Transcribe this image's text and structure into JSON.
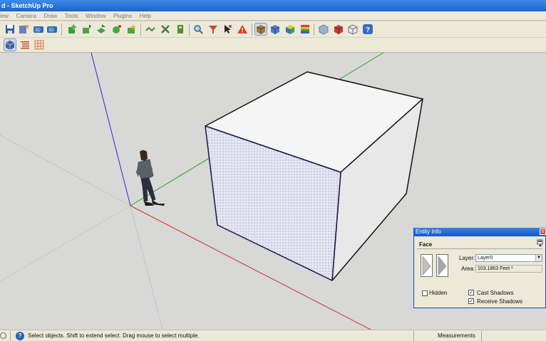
{
  "window": {
    "title": "d - SketchUp Pro"
  },
  "menu": [
    "View",
    "Camera",
    "Draw",
    "Tools",
    "Window",
    "Plugins",
    "Help"
  ],
  "menu_visible_text": [
    "iew",
    "Camera",
    "Draw",
    "Tools",
    "Window",
    "Plugins",
    "Help"
  ],
  "toolbar1": [
    {
      "icon": "save-icon",
      "color": "#3a5aa8"
    },
    {
      "icon": "save-model-icon",
      "color": "#6b7fc0"
    },
    {
      "icon": "upload-3dw-icon",
      "color": "#2f6ab5"
    },
    {
      "icon": "export-3dw-icon",
      "color": "#2f6ab5"
    },
    {
      "icon": "get-models-icon",
      "color": "#3c9a3a"
    },
    {
      "icon": "share-model-icon",
      "color": "#4aa444"
    },
    {
      "icon": "share-component-icon",
      "color": "#4aa444"
    },
    {
      "icon": "get-photo-texture-icon",
      "color": "#4aa444"
    },
    {
      "icon": "add-location-icon",
      "color": "#4aa444"
    },
    {
      "icon": "toggle-terrain-icon",
      "color": "#4a8a3a"
    },
    {
      "icon": "mirror-icon",
      "color": "#4a7a3a"
    },
    {
      "icon": "weld-icon",
      "color": "#5a8a2a"
    },
    {
      "icon": "zoom-magnifier-icon",
      "color": "#3060b0"
    },
    {
      "icon": "funnel-filter-icon",
      "color": "#c04a30"
    },
    {
      "icon": "select-arrow-icon",
      "color": "#222222"
    },
    {
      "icon": "warning-icon",
      "color": "#d64020"
    },
    {
      "icon": "shaded-box-icon",
      "color": "#a87840"
    },
    {
      "icon": "textured-box-icon",
      "color": "#5080c0"
    },
    {
      "icon": "colored-box-icon",
      "color": "#40a040"
    },
    {
      "icon": "rainbow-icon",
      "color": "#d04040"
    },
    {
      "icon": "component-box-icon",
      "color": "#6080b0"
    },
    {
      "icon": "red-box-icon",
      "color": "#c04040"
    },
    {
      "icon": "outline-box-icon",
      "color": "#808080"
    },
    {
      "icon": "help-icon",
      "color": "#3a6ac0"
    }
  ],
  "toolbar2": [
    {
      "icon": "component-cube-icon",
      "color": "#4060a0"
    },
    {
      "icon": "outliner-list-icon",
      "color": "#c05020"
    },
    {
      "icon": "spreadsheet-icon",
      "color": "#d08050"
    }
  ],
  "entity_info": {
    "title": "Entity Info",
    "close_label": "x",
    "type": "Face",
    "layer_label": "Layer:",
    "layer_value": "Layer0",
    "area_label": "Area:",
    "area_value": "103.1863 Feet ²",
    "hidden_label": "Hidden",
    "hidden_checked": false,
    "cast_shadows_label": "Cast Shadows",
    "cast_shadows_checked": true,
    "receive_shadows_label": "Receive Shadows",
    "receive_shadows_checked": true
  },
  "status": {
    "text": "Select objects. Shift to extend select. Drag mouse to select multiple.",
    "measurements_label": "Measurements",
    "help_glyph": "?"
  },
  "colors": {
    "x_axis": "#c83030",
    "y_axis": "#30a030",
    "z_axis": "#2a2ad0",
    "viewport_bg": "#d8d8d6",
    "front_face": "#e3e3ee",
    "right_face": "#e8e8e8",
    "top_face": "#f5f5f5",
    "title_blue": "#1b63d1"
  }
}
